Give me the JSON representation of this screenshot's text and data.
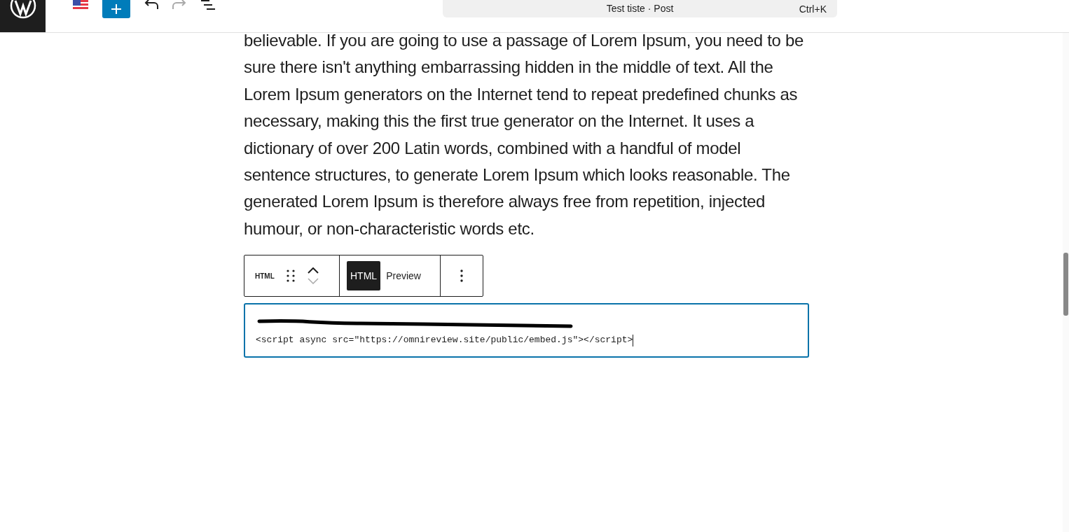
{
  "header": {
    "title": "Test tiste · Post",
    "shortcut": "Ctrl+K"
  },
  "paragraph": "believable. If you are going to use a passage of Lorem Ipsum, you need to be sure there isn't anything embarrassing hidden in the middle of text. All the Lorem Ipsum generators on the Internet tend to repeat predefined chunks as necessary, making this the first true generator on the Internet. It uses a dictionary of over 200 Latin words, combined with a handful of model sentence structures, to generate Lorem Ipsum which looks reasonable. The generated Lorem Ipsum is therefore always free from repetition, injected humour, or non-characteristic words etc.",
  "block_toolbar": {
    "block_label": "HTML",
    "tabs": [
      {
        "label": "HTML",
        "selected": true
      },
      {
        "label": "Preview",
        "selected": false
      }
    ]
  },
  "code_lines": [
    {
      "kind": "redacted"
    },
    {
      "kind": "text",
      "text": "<script async src=\"https://omnireview.site/public/embed.js\"></script>"
    }
  ]
}
